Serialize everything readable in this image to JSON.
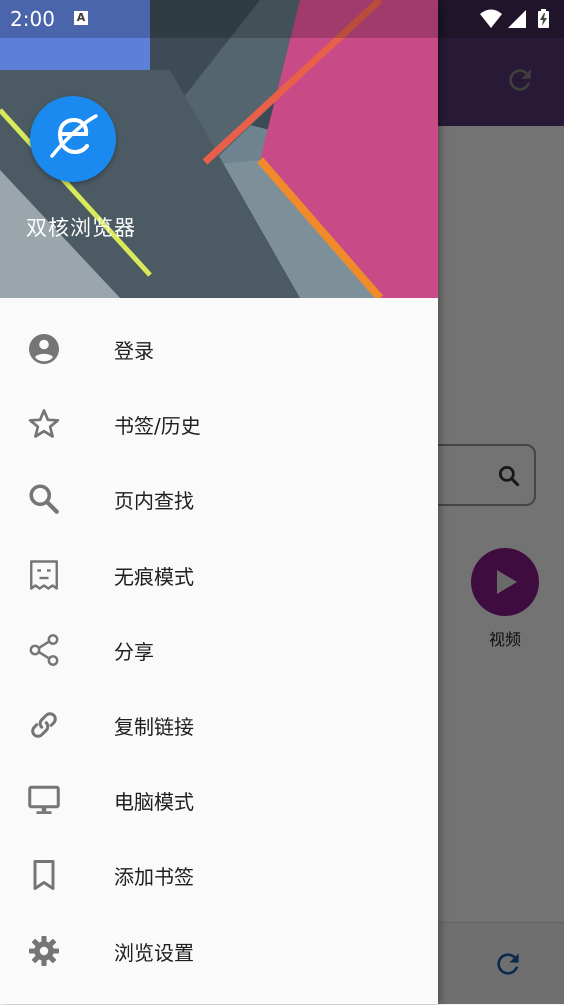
{
  "status_bar": {
    "time": "2:00",
    "notification_glyph": "A",
    "icons": [
      "wifi-icon",
      "cell-signal-icon",
      "battery-charging-icon"
    ]
  },
  "background_app": {
    "video_label": "视频"
  },
  "drawer": {
    "app_name": "双核浏览器",
    "items": [
      {
        "label": "登录",
        "icon": "account-circle-icon"
      },
      {
        "label": "书签/历史",
        "icon": "star-outline-icon"
      },
      {
        "label": "页内查找",
        "icon": "search-icon"
      },
      {
        "label": "无痕模式",
        "icon": "incognito-ticket-icon"
      },
      {
        "label": "分享",
        "icon": "share-icon"
      },
      {
        "label": "复制链接",
        "icon": "link-icon"
      },
      {
        "label": "电脑模式",
        "icon": "desktop-monitor-icon"
      },
      {
        "label": "添加书签",
        "icon": "bookmark-outline-icon"
      },
      {
        "label": "浏览设置",
        "icon": "settings-gear-icon"
      }
    ]
  },
  "colors": {
    "toolbar": "#5a3a78",
    "logo": "#1a8af0",
    "video_button": "#8a1c8c",
    "icon": "#757575"
  }
}
